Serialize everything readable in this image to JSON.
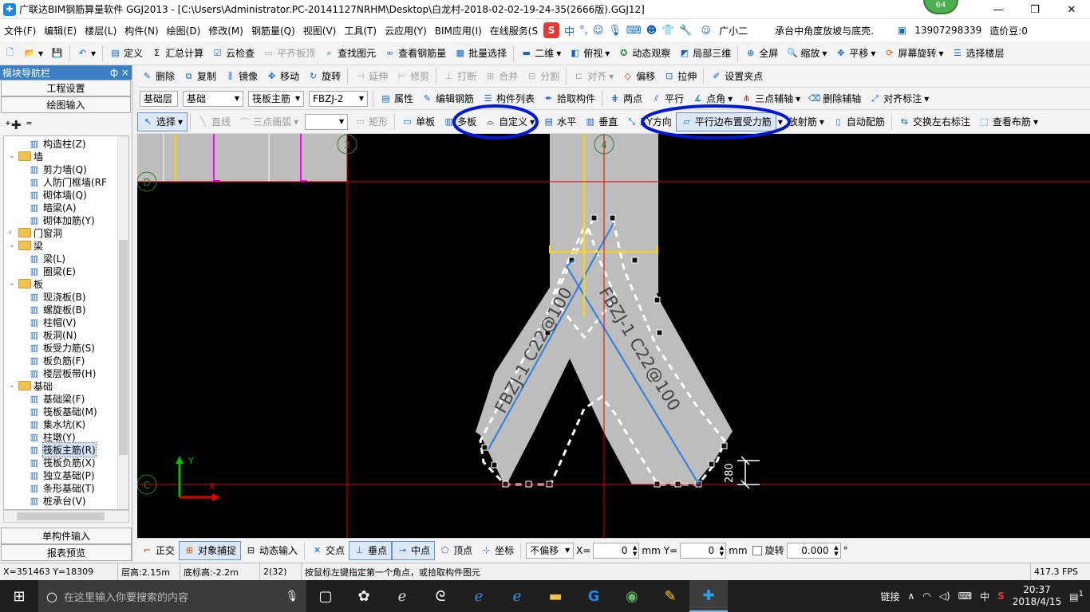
{
  "window": {
    "title": "广联达BIM钢筋算量软件 GGJ2013 - [C:\\Users\\Administrator.PC-20141127NRHM\\Desktop\\白龙村-2018-02-02-19-24-35(2666版).GGJ12]",
    "badge": "64",
    "min": "—",
    "restore": "❐",
    "close": "✕"
  },
  "menu": {
    "items": [
      "文件(F)",
      "编辑(E)",
      "楼层(L)",
      "构件(N)",
      "绘图(D)",
      "修改(M)",
      "钢筋量(Q)",
      "视图(V)",
      "工具(T)",
      "云应用(Y)",
      "BIM应用(I)",
      "在线服务(S"
    ],
    "ime_text": "中",
    "helper": "广小二",
    "question": "承台中角度放坡与底壳.",
    "phone": "13907298339",
    "beans": "造价豆:0"
  },
  "toolbar1": {
    "define": "定义",
    "sum": "汇总计算",
    "cloud_check": "云检查",
    "flush_top": "平齐板顶",
    "find": "查找图元",
    "view_rebar": "查看钢筋量",
    "batch_select": "批量选择",
    "view_2d": "二维",
    "top_view": "俯视",
    "dyn_view": "动态观察",
    "local_3d": "局部三维",
    "full": "全屏",
    "zoom": "缩放",
    "pan": "平移",
    "rotate_screen": "屏幕旋转",
    "select_floor": "选择楼层"
  },
  "panel": {
    "title": "模块导航栏",
    "pin": "ф ×",
    "project_settings": "工程设置",
    "drawing_input": "绘图输入",
    "single_input": "单构件输入",
    "report_preview": "报表预览",
    "tree": [
      {
        "label": "构造柱(Z)",
        "level": 2,
        "icon": "▥"
      },
      {
        "label": "墙",
        "level": 0,
        "folder": true,
        "exp": "⌄"
      },
      {
        "label": "剪力墙(Q)",
        "level": 2,
        "icon": "▥"
      },
      {
        "label": "人防门框墙(RF",
        "level": 2,
        "icon": "▥"
      },
      {
        "label": "砌体墙(Q)",
        "level": 2,
        "icon": "▥"
      },
      {
        "label": "暗梁(A)",
        "level": 2,
        "icon": "▥"
      },
      {
        "label": "砌体加筋(Y)",
        "level": 2,
        "icon": "▥"
      },
      {
        "label": "门窗洞",
        "level": 0,
        "folder": true,
        "exp": "›"
      },
      {
        "label": "梁",
        "level": 0,
        "folder": true,
        "exp": "⌄"
      },
      {
        "label": "梁(L)",
        "level": 2,
        "icon": "▥"
      },
      {
        "label": "圈梁(E)",
        "level": 2,
        "icon": "▥"
      },
      {
        "label": "板",
        "level": 0,
        "folder": true,
        "exp": "⌄"
      },
      {
        "label": "现浇板(B)",
        "level": 2,
        "icon": "▥"
      },
      {
        "label": "螺旋板(B)",
        "level": 2,
        "icon": "▥"
      },
      {
        "label": "柱帽(V)",
        "level": 2,
        "icon": "▥"
      },
      {
        "label": "板洞(N)",
        "level": 2,
        "icon": "▥"
      },
      {
        "label": "板受力筋(S)",
        "level": 2,
        "icon": "▥"
      },
      {
        "label": "板负筋(F)",
        "level": 2,
        "icon": "▥"
      },
      {
        "label": "楼层板带(H)",
        "level": 2,
        "icon": "▥"
      },
      {
        "label": "基础",
        "level": 0,
        "folder": true,
        "exp": "⌄"
      },
      {
        "label": "基础梁(F)",
        "level": 2,
        "icon": "▥"
      },
      {
        "label": "筏板基础(M)",
        "level": 2,
        "icon": "▥"
      },
      {
        "label": "集水坑(K)",
        "level": 2,
        "icon": "▥"
      },
      {
        "label": "柱墩(Y)",
        "level": 2,
        "icon": "▥"
      },
      {
        "label": "筏板主筋(R)",
        "level": 2,
        "icon": "▥",
        "selected": true
      },
      {
        "label": "筏板负筋(X)",
        "level": 2,
        "icon": "▥"
      },
      {
        "label": "独立基础(P)",
        "level": 2,
        "icon": "▥"
      },
      {
        "label": "条形基础(T)",
        "level": 2,
        "icon": "▥"
      },
      {
        "label": "桩承台(V)",
        "level": 2,
        "icon": "▥"
      }
    ]
  },
  "toolbar2": {
    "delete": "删除",
    "copy": "复制",
    "mirror": "镜像",
    "move": "移动",
    "rotate": "旋转",
    "extend": "延伸",
    "trim": "修剪",
    "break": "打断",
    "merge": "合并",
    "split": "分割",
    "align": "对齐",
    "offset": "偏移",
    "stretch": "拉伸",
    "set_grip": "设置夹点"
  },
  "toolbar3": {
    "layer": "基础层",
    "category": "基础",
    "type": "筏板主筋",
    "member": "FBZJ-2",
    "props": "属性",
    "edit_rebar": "编辑钢筋",
    "member_list": "构件列表",
    "pick_member": "拾取构件",
    "two_points": "两点",
    "parallel": "平行",
    "point_angle": "点角",
    "three_point_axis": "三点辅轴",
    "delete_axis": "删除辅轴",
    "align_dim": "对齐标注"
  },
  "toolbar4": {
    "select": "选择",
    "line": "直线",
    "arc": "三点画弧",
    "shape_value": "",
    "rect": "矩形",
    "single_board": "单板",
    "multi_board": "多板",
    "custom": "自定义",
    "horizontal": "水平",
    "vertical": "垂直",
    "xy_dir": "XY方向",
    "parallel_edge": "平行边布置受力筋",
    "radial": "放射筋",
    "auto_rebar": "自动配筋",
    "swap_labels": "交换左右标注",
    "view_layout": "查看布筋"
  },
  "canvas": {
    "axis_labels": {
      "a3": "3",
      "a4": "4",
      "aD": "D",
      "aC": "C"
    },
    "rebar_left": "FBZJ-1 C22@100",
    "rebar_right": "FBZJ-1 C22@100",
    "dim": "280",
    "ucs_x": "X",
    "ucs_y": "Y"
  },
  "snapbar": {
    "ortho": "正交",
    "osnap": "对象捕捉",
    "dyn_input": "动态输入",
    "intersect": "交点",
    "perp": "垂点",
    "mid": "中点",
    "vertex": "顶点",
    "coord": "坐标",
    "offset_mode": "不偏移",
    "x_label": "X=",
    "x_value": "0",
    "y_label": "Y=",
    "y_value": "0",
    "unit": "mm",
    "rotate": "旋转",
    "rotate_value": "0.000",
    "degree": "°"
  },
  "status": {
    "coords": "X=351463 Y=18309",
    "floor_h": "层高:2.15m",
    "bottom_h": "底标高:-2.2m",
    "count": "2(32)",
    "hint": "按鼠标左键指定第一个角点，或拾取构件图元",
    "fps": "417.3 FPS"
  },
  "taskbar": {
    "search_placeholder": "在这里输入你要搜索的内容",
    "link": "链接",
    "ime": "中",
    "time": "20:37",
    "date": "2018/4/15",
    "notifications": "1"
  },
  "colors": {
    "annot": "#0018d8",
    "rebar": "#2f7de0",
    "axis": "#e00000",
    "slab": "#bdbdbd"
  }
}
